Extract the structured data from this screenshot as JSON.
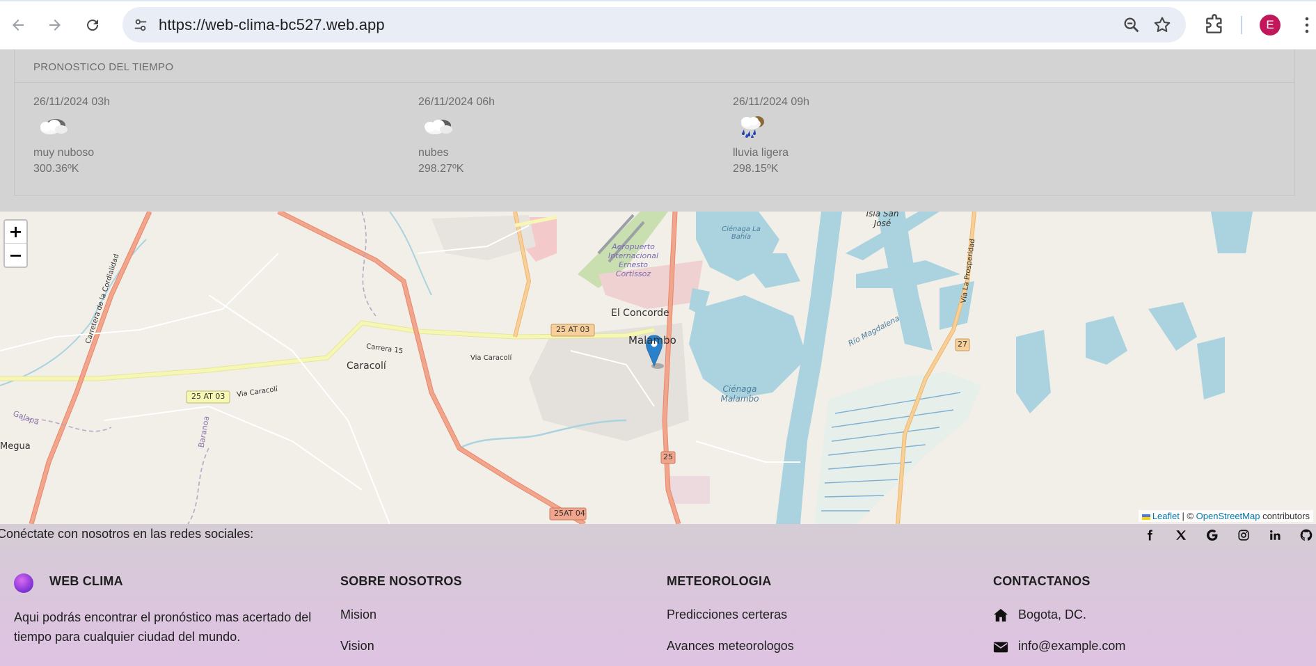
{
  "browser": {
    "url": "https://web-clima-bc527.web.app",
    "profile_initial": "E",
    "profile_color": "#c2185b"
  },
  "forecast": {
    "title": "PRONOSTICO DEL TIEMPO",
    "items": [
      {
        "date": "26/11/2024 03h",
        "icon": "overcast-cloud-icon",
        "description": "muy nuboso",
        "temp": "300.36ºK"
      },
      {
        "date": "26/11/2024 06h",
        "icon": "cloud-icon",
        "description": "nubes",
        "temp": "298.27ºK"
      },
      {
        "date": "26/11/2024 09h",
        "icon": "rain-cloud-icon",
        "description": "lluvia ligera",
        "temp": "298.15ºK"
      }
    ]
  },
  "map": {
    "zoom_in": "+",
    "zoom_out": "−",
    "attribution": {
      "leaflet": "Leaflet",
      "sep": " | © ",
      "osm": "OpenStreetMap",
      "tail": " contributors"
    },
    "labels": {
      "el_concorde": "El Concorde",
      "malambo": "Malambo",
      "caracoli": "Caracolí",
      "megua": "Megua",
      "cienaga_malambo": "Ciénaga Malambo",
      "cienaga_bahia": "Ciénaga La Bahía",
      "isla_san_jose": "Isla San José",
      "aeropuerto": "Aeropuerto Internacional Ernesto Cortissoz",
      "via_caracoli": "Via Caracolí",
      "carrera_15": "Carrera 15",
      "route_25at03": "25 AT 03",
      "route_25at04": "25AT 04",
      "route_25": "25",
      "route_27": "27",
      "rio_magdalena": "Río Magdalena",
      "via_prosperidad": "Vía La Prosperidad",
      "carretera_cordialidad": "Carretera de la Cordialidad",
      "galapa": "Galapa",
      "baranoa": "Baranoa"
    },
    "colors": {
      "water": "#aad3df",
      "land": "#f2efe9",
      "primary_road": "#f1a58c",
      "secondary_road": "#f6cf9a",
      "tertiary_road": "#f7f7b5",
      "marker": "#2a81cb"
    }
  },
  "footer": {
    "social_text": "Conéctate con nosotros en las redes sociales:",
    "social_icons": [
      "facebook-icon",
      "x-icon",
      "google-icon",
      "instagram-icon",
      "linkedin-icon",
      "github-icon"
    ],
    "brand": {
      "title": "WEB CLIMA",
      "text": "Aqui podrás encontrar el pronóstico mas acertado del tiempo para cualquier ciudad del mundo."
    },
    "about": {
      "title": "SOBRE NOSOTROS",
      "links": [
        "Mision",
        "Vision"
      ]
    },
    "meteo": {
      "title": "METEOROLOGIA",
      "links": [
        "Predicciones certeras",
        "Avances meteorologos"
      ]
    },
    "contact": {
      "title": "CONTACTANOS",
      "address": "Bogota, DC.",
      "email": "info@example.com"
    }
  }
}
